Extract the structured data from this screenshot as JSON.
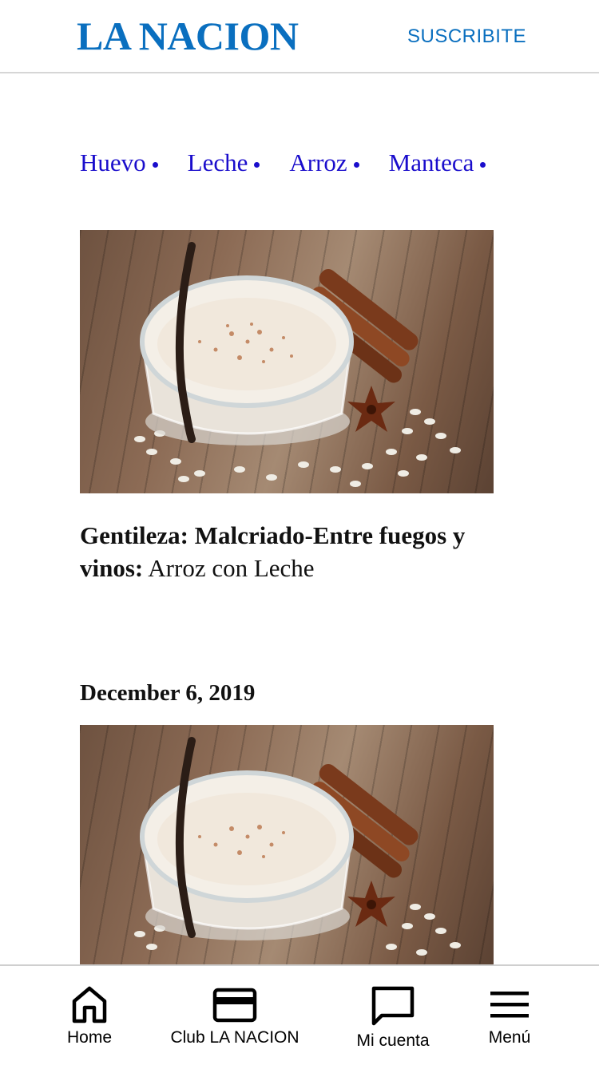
{
  "header": {
    "logo": "LA NACION",
    "subscribe_label": "SUSCRIBITE"
  },
  "tags": [
    "Huevo",
    "Leche",
    "Arroz",
    "Manteca"
  ],
  "article": {
    "caption_credit": "Gentileza: Malcriado-Entre fuegos y vinos:",
    "caption_title": "Arroz con Leche",
    "date": "December 6, 2019"
  },
  "bottom_nav": {
    "items": [
      {
        "label": "Home",
        "icon": "home-icon"
      },
      {
        "label": "Club LA NACION",
        "icon": "card-icon"
      },
      {
        "label": "Mi cuenta",
        "icon": "chat-bubble-icon"
      },
      {
        "label": "Menú",
        "icon": "hamburger-menu-icon"
      }
    ]
  },
  "colors": {
    "brand_blue": "#0a6fbf",
    "tag_blue": "#1a0dcc",
    "text": "#111111"
  }
}
